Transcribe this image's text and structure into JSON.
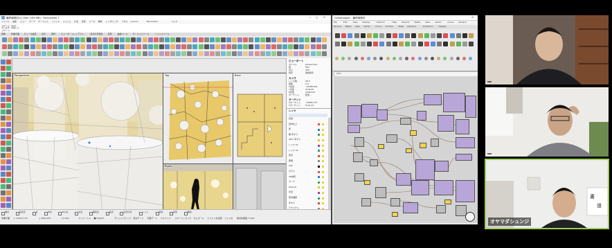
{
  "rhino": {
    "title": "最終案検討(2).3dm (163 MB) - Rhinoceros 7",
    "menu": [
      "ファイル",
      "編集",
      "ビュー",
      "カーブ",
      "サーフェス",
      "ソリッド",
      "メッシュ",
      "寸法",
      "変形",
      "ツール",
      "解析",
      "レンダリング",
      "パネル",
      "Lumion",
      "Twinmotion",
      "ヘルプ"
    ],
    "command_lines": [
      "コマンド: Undo",
      "元に戻す: 変更した",
      "コマンド:"
    ],
    "toolbar_tabs": [
      "標準",
      "作業平面",
      "ビューの設定",
      "表示",
      "選択",
      "ビューポートレイアウト",
      "表示の可視性",
      "変形",
      "曲線ツール",
      "サーフェスツール",
      "ソリッドツール"
    ],
    "viewports": {
      "perspective": "Perspective",
      "top": "Top",
      "back": "Back",
      "right": "Right"
    },
    "viewport_tabs": "Perspective | Top | Left | Back",
    "properties": {
      "title": "ビューポート",
      "rows": [
        [
          "タイトル",
          "Perspective"
        ],
        [
          "幅",
          "884"
        ],
        [
          "高さ",
          "358"
        ],
        [
          "投影",
          "透視投影"
        ]
      ],
      "camera_title": "カメラ",
      "camera_rows": [
        [
          "レンズ長",
          "28.0"
        ],
        [
          "回転",
          "0.0"
        ],
        [
          "X位置",
          "-15288.509"
        ],
        [
          "Y位置",
          "4136.87"
        ],
        [
          "Z位置",
          "1048.013"
        ],
        [
          "ターゲット",
          "配置..."
        ]
      ],
      "target_title": "ターゲット",
      "target_rows": [
        [
          "Xターゲット",
          "-15885.737"
        ],
        [
          "Yターゲット",
          "5141.47"
        ]
      ]
    },
    "layers": {
      "title": "レイヤ",
      "items": [
        "名前",
        "室内仕上",
        "床",
        "棚 手すり",
        "ANTI 手すり",
        "レイヤ 01",
        "レイヤ 02",
        "家具",
        "照明",
        "Site",
        "ガラス",
        "3D地形",
        "カーブ",
        "Default",
        "木目",
        "家具細部",
        "手すり",
        "テクスチャ"
      ]
    },
    "osnap": [
      "端点",
      "近接点",
      "点",
      "中点",
      "中心点",
      "交点",
      "垂直点",
      "接点",
      "四分円点",
      "ノット",
      "頂点",
      "投影",
      "無効"
    ],
    "status": [
      "作業平面",
      "x -14337.133",
      "y 4560.631",
      "z 0.000",
      "ミリメートル",
      "■ Default",
      "グリッドスナップ",
      "直交モード",
      "平面モード",
      "Oスナップ",
      "スマートトラック",
      "ガムボール",
      "ヒストリを記録",
      "フィルタ",
      "絶対許容差: 0.001"
    ]
  },
  "grasshopper": {
    "title": "Grasshopper - 最終案検討",
    "menu": [
      "File",
      "Edit",
      "View",
      "Display",
      "Solution",
      "Help",
      "Params",
      "Maths",
      "Sets",
      "Vector",
      "Curve",
      "Surface"
    ],
    "tabs": [
      "Params",
      "Maths",
      "Sets",
      "Vector",
      "Curve",
      "Surface",
      "Mesh",
      "Intersect",
      "Transform",
      "Display"
    ],
    "zoom": "54%",
    "filename": "最終案検討"
  },
  "meeting": {
    "participants": [
      {
        "name": ""
      },
      {
        "name": ""
      },
      {
        "name": "オヤマダシュンジ"
      }
    ],
    "active_speaker_color": "#9bd15b"
  }
}
